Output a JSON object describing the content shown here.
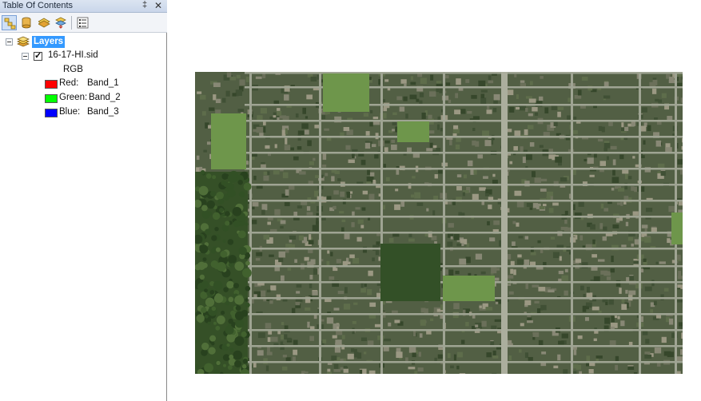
{
  "toc": {
    "title": "Table Of Contents",
    "pin_glyph": "‡",
    "close_glyph": "✕",
    "toolbar": {
      "buttons": [
        "list-by-drawing-order-icon",
        "list-by-source-icon",
        "list-by-visibility-icon",
        "list-by-selection-icon",
        "options-icon"
      ]
    },
    "tree": {
      "root": {
        "label": "Layers",
        "expanded": true
      },
      "layer": {
        "label": "16-17-HI.sid",
        "checked": true,
        "expanded": true,
        "symbology_heading": "RGB"
      },
      "bands": [
        {
          "channel": "Red:",
          "band": "Band_1",
          "color": "#ff0000"
        },
        {
          "channel": "Green:",
          "band": "Band_2",
          "color": "#00ff00"
        },
        {
          "channel": "Blue:",
          "band": "Band_3",
          "color": "#0000ff"
        }
      ]
    }
  },
  "map": {
    "imagery": "aerial-orthophoto",
    "colors": {
      "canopy": "#2e4a22",
      "street": "#a7aa9c",
      "block": "#4f5c43",
      "field": "#6f9a4a"
    }
  }
}
